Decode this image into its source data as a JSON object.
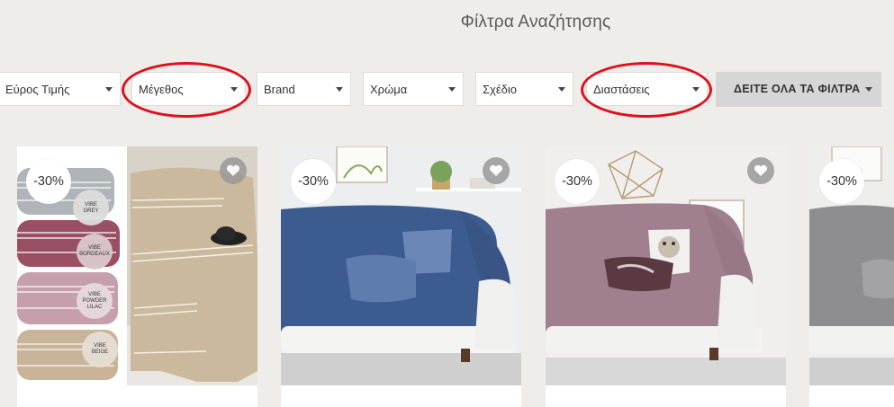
{
  "header": {
    "title": "Φίλτρα Αναζήτησης"
  },
  "filters": {
    "price": "Εύρος Τιμής",
    "size": "Μέγεθος",
    "brand": "Brand",
    "color": "Χρώμα",
    "design": "Σχέδιο",
    "dimensions": "Διαστάσεις",
    "all_filters": "ΔΕΙΤΕ ΟΛΑ ΤΑ ΦΙΛΤΡΑ"
  },
  "products": [
    {
      "discount": "-30%",
      "swatches": [
        {
          "label": "VIBE\nGREY",
          "color": "#aeb4b8"
        },
        {
          "label": "VIBE\nBORDEAUX",
          "color": "#9a4f62"
        },
        {
          "label": "VIBE\nPOWDER\nLILAC",
          "color": "#c5a0ac"
        },
        {
          "label": "VIBE\nBEIGE",
          "color": "#c9b49a"
        }
      ]
    },
    {
      "discount": "-30%",
      "color": "#3c5b8e"
    },
    {
      "discount": "-30%",
      "color": "#a0808f"
    },
    {
      "discount": "-30%",
      "color": "#8e8e90"
    }
  ],
  "colors": {
    "background": "#efedea",
    "highlight_ring": "#e0101b",
    "all_filters_bg": "#d6d6d6"
  }
}
